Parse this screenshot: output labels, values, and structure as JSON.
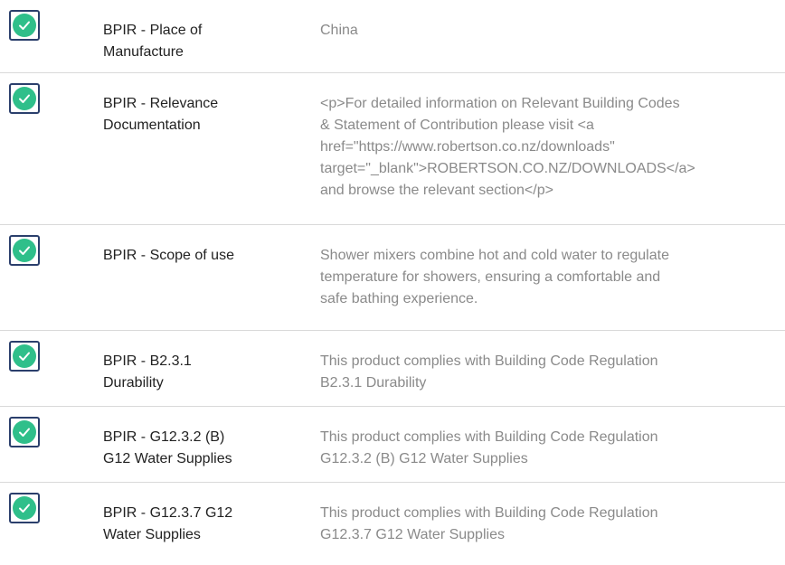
{
  "rows": [
    {
      "label_line1": "BPIR - Place of",
      "label_line2": "Manufacture",
      "value_lines": [
        "China"
      ],
      "status_icon": "check-circle-icon",
      "checked": true
    },
    {
      "label_line1": "BPIR - Relevance",
      "label_line2": "Documentation",
      "value_lines": [
        "<p>For detailed information on Relevant Building Codes",
        "& Statement of Contribution please visit <a",
        "href=\"https://www.robertson.co.nz/downloads\"",
        "target=\"_blank\">ROBERTSON.CO.NZ/DOWNLOADS</a>",
        "and browse the relevant section</p>"
      ],
      "status_icon": "check-circle-icon",
      "checked": true
    },
    {
      "label_line1": "BPIR - Scope of use",
      "label_line2": "",
      "value_lines": [
        "Shower mixers combine hot and cold water to regulate",
        "temperature for showers, ensuring a comfortable and",
        "safe bathing experience."
      ],
      "status_icon": "check-circle-icon",
      "checked": true
    },
    {
      "label_line1": "BPIR - B2.3.1",
      "label_line2": "Durability",
      "value_lines": [
        "This product complies with Building Code Regulation",
        "B2.3.1 Durability"
      ],
      "status_icon": "check-circle-icon",
      "checked": true
    },
    {
      "label_line1": "BPIR - G12.3.2 (B)",
      "label_line2": "G12 Water Supplies",
      "value_lines": [
        "This product complies with Building Code Regulation",
        "G12.3.2 (B) G12 Water Supplies"
      ],
      "status_icon": "check-circle-icon",
      "checked": true
    },
    {
      "label_line1": "BPIR - G12.3.7 G12",
      "label_line2": "Water Supplies",
      "value_lines": [
        "This product complies with Building Code Regulation",
        "G12.3.7 G12 Water Supplies"
      ],
      "status_icon": "check-circle-icon",
      "checked": true
    }
  ],
  "colors": {
    "check_fill": "#2fbf8a",
    "check_border": "#2b3f6c",
    "label_text": "#222222",
    "value_text": "#8a8a8a",
    "divider": "#d9d9d9"
  }
}
